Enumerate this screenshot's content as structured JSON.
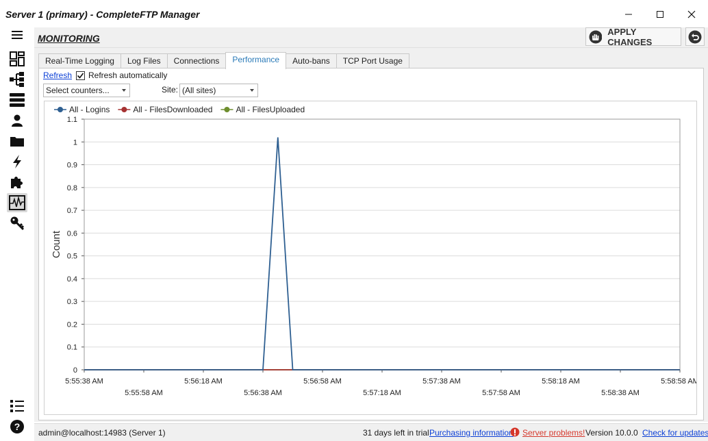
{
  "window": {
    "title": "Server 1 (primary) - CompleteFTP Manager"
  },
  "sidebar": {
    "items": [
      {
        "icon": "menu-icon"
      },
      {
        "icon": "dashboard-icon"
      },
      {
        "icon": "network-icon"
      },
      {
        "icon": "servers-icon"
      },
      {
        "icon": "user-icon"
      },
      {
        "icon": "folder-icon"
      },
      {
        "icon": "lightning-icon"
      },
      {
        "icon": "puzzle-icon"
      },
      {
        "icon": "monitoring-icon"
      },
      {
        "icon": "key-icon"
      },
      {
        "icon": "list-icon"
      },
      {
        "icon": "help-icon"
      }
    ]
  },
  "header": {
    "title": "MONITORING",
    "apply_label": "APPLY CHANGES"
  },
  "tabs": [
    {
      "label": "Real-Time Logging",
      "active": false
    },
    {
      "label": "Log Files",
      "active": false
    },
    {
      "label": "Connections",
      "active": false
    },
    {
      "label": "Performance",
      "active": true
    },
    {
      "label": "Auto-bans",
      "active": false
    },
    {
      "label": "TCP Port Usage",
      "active": false
    }
  ],
  "controls": {
    "refresh_label": "Refresh",
    "auto_refresh_label": "Refresh automatically",
    "auto_refresh_checked": true,
    "counters_select": "Select counters...",
    "site_label": "Site:",
    "site_select": "(All sites)"
  },
  "chart_data": {
    "type": "line",
    "title": "",
    "xlabel": "",
    "ylabel": "Count",
    "ylim": [
      0,
      1.1
    ],
    "yticks": [
      "0",
      "0.1",
      "0.2",
      "0.3",
      "0.4",
      "0.5",
      "0.6",
      "0.7",
      "0.8",
      "0.9",
      "1",
      "1.1"
    ],
    "xticks_top": [
      "5:55:38 AM",
      "5:56:18 AM",
      "5:56:58 AM",
      "5:57:38 AM",
      "5:58:18 AM",
      "5:58:58 AM"
    ],
    "xticks_bottom": [
      "5:55:58 AM",
      "5:56:38 AM",
      "5:57:18 AM",
      "5:57:58 AM",
      "5:58:38 AM"
    ],
    "grid": true,
    "legend_position": "top-left",
    "series": [
      {
        "name": "All - Logins",
        "color": "#2e5f91",
        "points": [
          [
            "5:55:38 AM",
            0
          ],
          [
            "5:56:38 AM",
            0
          ],
          [
            "5:56:43 AM",
            1.02
          ],
          [
            "5:56:48 AM",
            0
          ],
          [
            "5:58:58 AM",
            0
          ]
        ]
      },
      {
        "name": "All - FilesDownloaded",
        "color": "#a63232",
        "points": [
          [
            "5:55:38 AM",
            0
          ],
          [
            "5:58:58 AM",
            0
          ]
        ]
      },
      {
        "name": "All - FilesUploaded",
        "color": "#6e8e2e",
        "points": [
          [
            "5:55:38 AM",
            0
          ],
          [
            "5:58:58 AM",
            0
          ]
        ]
      }
    ]
  },
  "status": {
    "user": "admin@localhost:14983 (Server 1)",
    "trial": "31 days left in trial",
    "purchasing": "Purchasing information",
    "problems": "Server problems!",
    "version": "Version 10.0.0",
    "updates": "Check for updates"
  }
}
